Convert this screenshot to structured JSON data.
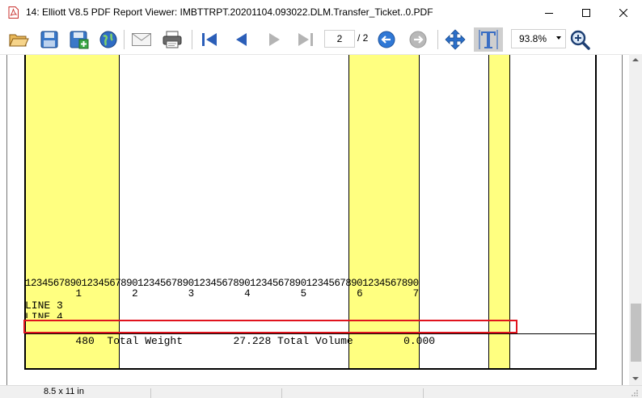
{
  "window": {
    "title": "14: Elliott V8.5 PDF Report Viewer: IMBTTRPT.20201104.093022.DLM.Transfer_Ticket..0.PDF",
    "icon": "pdf-file-icon",
    "controls": [
      "minimize-icon",
      "maximize-icon",
      "close-icon"
    ]
  },
  "toolbar": {
    "buttons": [
      {
        "name": "open-button",
        "icon": "folder-open-icon"
      },
      {
        "name": "save-button",
        "icon": "save-disk-icon"
      },
      {
        "name": "save-as-button",
        "icon": "save-plus-icon"
      },
      {
        "name": "web-button",
        "icon": "globe-icon"
      },
      {
        "name": "email-button",
        "icon": "envelope-icon"
      },
      {
        "name": "print-button",
        "icon": "printer-icon"
      },
      {
        "name": "first-page-button",
        "icon": "first-page-icon"
      },
      {
        "name": "prev-page-button",
        "icon": "prev-page-icon"
      },
      {
        "name": "next-page-button",
        "icon": "next-page-icon"
      },
      {
        "name": "last-page-button",
        "icon": "last-page-icon"
      },
      {
        "name": "back-button",
        "icon": "back-circle-icon"
      },
      {
        "name": "forward-button",
        "icon": "forward-circle-icon"
      },
      {
        "name": "pan-button",
        "icon": "move-arrows-icon"
      },
      {
        "name": "text-select-button",
        "icon": "text-cursor-icon"
      },
      {
        "name": "zoom-in-button",
        "icon": "zoom-in-icon"
      }
    ],
    "page_current": "2",
    "page_total": "/ 2",
    "zoom": "93.8%",
    "active_tool": "text-select"
  },
  "document": {
    "highlight_color": "#ffff80",
    "ruler_digits": "1234567890123456789012345678901234567890123456789012345678901234567890",
    "ruler_tens": "         1         2         3         4         5         6         7",
    "line3": "LINE 3",
    "line4": "LINE 4",
    "total_row": "        480  Total Weight        27.228 Total Volume        0.000",
    "selection_color": "#e0141e"
  },
  "status": {
    "paper_size": "8.5 x 11 in"
  }
}
